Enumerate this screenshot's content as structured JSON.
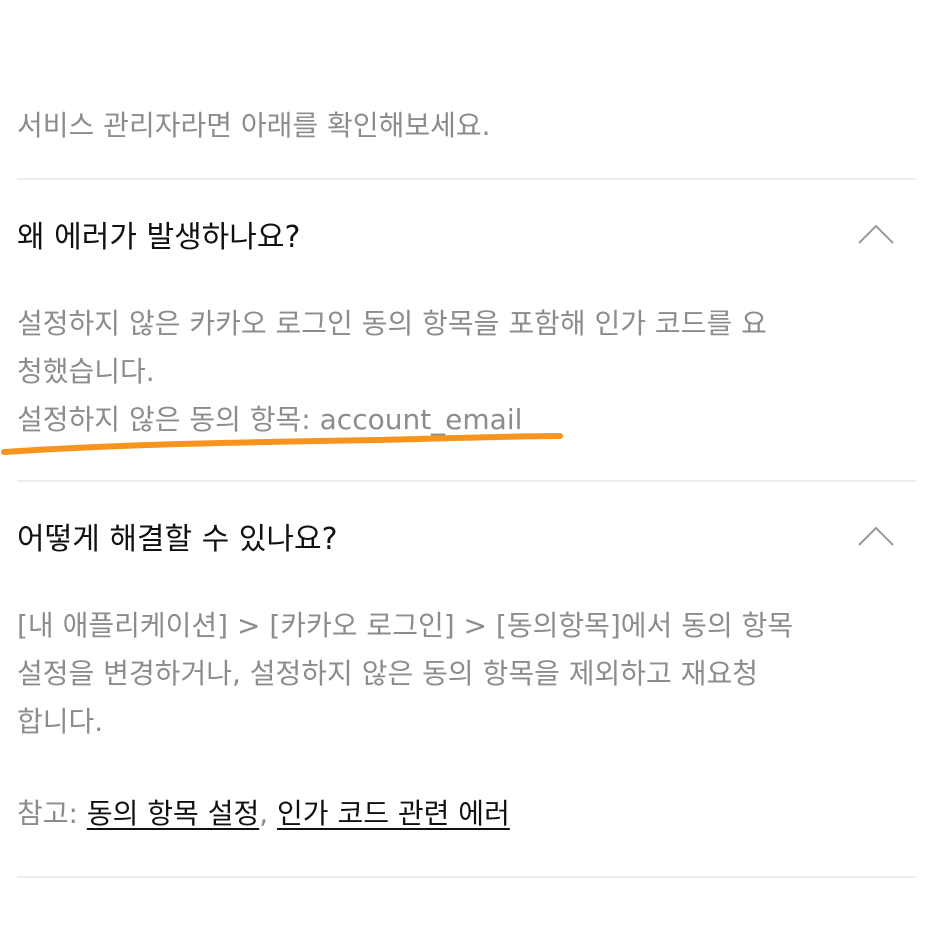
{
  "intro": {
    "text": "서비스 관리자라면 아래를 확인해보세요."
  },
  "sections": [
    {
      "title": "왜 에러가 발생하나요?",
      "expanded": true,
      "chevron_icon": "chevron-up-icon",
      "lines": [
        "설정하지 않은 카카오 로그인 동의 항목을 포함해 인가 코드를 요",
        "청했습니다.",
        "설정하지 않은 동의 항목: account_email"
      ]
    },
    {
      "title": "어떻게 해결할 수 있나요?",
      "expanded": true,
      "chevron_icon": "chevron-up-icon",
      "lines": [
        "[내 애플리케이션] > [카카오 로그인] > [동의항목]에서 동의 항목",
        "설정을 변경하거나, 설정하지 않은 동의 항목을 제외하고 재요청",
        "합니다."
      ]
    }
  ],
  "reference": {
    "label": "참고: ",
    "links": [
      "동의 항목 설정",
      "인가 코드 관련 에러"
    ],
    "separator": ", "
  },
  "colors": {
    "highlight": "#f7941d",
    "body_text": "#8c8c8c",
    "title_text": "#111111",
    "divider": "#ececec"
  }
}
